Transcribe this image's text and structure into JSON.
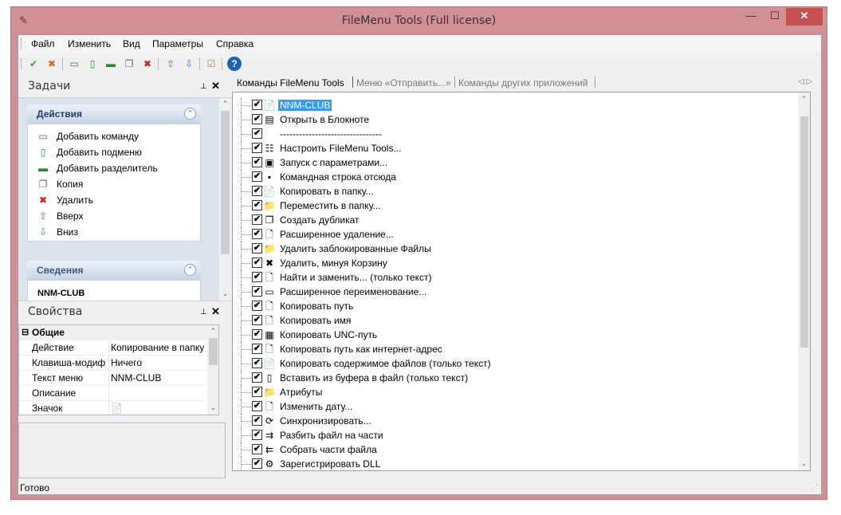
{
  "window": {
    "title": "FileMenu Tools (Full license)",
    "min_glyph": "—",
    "max_glyph": "☐",
    "close_glyph": "✕"
  },
  "menu": [
    "Файл",
    "Изменить",
    "Вид",
    "Параметры",
    "Справка"
  ],
  "toolbar": [
    {
      "icon": "apply-icon",
      "glyph": "✔",
      "color": "#2ea02e"
    },
    {
      "icon": "cancel-icon",
      "glyph": "✖",
      "color": "#e06020"
    },
    {
      "icon": "add-command-icon",
      "glyph": "▭",
      "color": "#2a8a2a"
    },
    {
      "icon": "add-submenu-icon",
      "glyph": "▯",
      "color": "#2a8a2a"
    },
    {
      "icon": "add-separator-icon",
      "glyph": "▬",
      "color": "#2a8a2a"
    },
    {
      "icon": "copy-icon",
      "glyph": "❐",
      "color": "#666666"
    },
    {
      "icon": "delete-icon",
      "glyph": "✖",
      "color": "#cc2020"
    },
    {
      "icon": "move-up-icon",
      "glyph": "⇧",
      "color": "#3a6fc4"
    },
    {
      "icon": "move-down-icon",
      "glyph": "⇩",
      "color": "#3a6fc4"
    },
    {
      "icon": "check-icon",
      "glyph": "☑",
      "color": "#c08030"
    },
    {
      "icon": "help-icon",
      "glyph": "?",
      "color": "#1f5fbf"
    }
  ],
  "tasks_pane": {
    "title": "Задачи",
    "pin_glyph": "⊥",
    "close_glyph": "✕",
    "actions_group": {
      "title": "Действия",
      "toggle_glyph": "⌃",
      "items": [
        {
          "label": "Добавить команду",
          "icon": "add-command-icon",
          "glyph": "▭",
          "color": "#2a8a2a"
        },
        {
          "label": "Добавить подменю",
          "icon": "add-submenu-icon",
          "glyph": "▯",
          "color": "#2a8a2a"
        },
        {
          "label": "Добавить разделитель",
          "icon": "add-separator-icon",
          "glyph": "▬",
          "color": "#2a8a2a"
        },
        {
          "label": "Копия",
          "icon": "copy-icon",
          "glyph": "❐",
          "color": "#666666"
        },
        {
          "label": "Удалить",
          "icon": "delete-icon",
          "glyph": "✖",
          "color": "#cc2020"
        },
        {
          "label": "Вверх",
          "icon": "move-up-icon",
          "glyph": "⇧",
          "color": "#3a6fc4"
        },
        {
          "label": "Вниз",
          "icon": "move-down-icon",
          "glyph": "⇩",
          "color": "#3a6fc4"
        }
      ]
    },
    "info_group": {
      "title": "Сведения",
      "toggle_glyph": "⌃",
      "partial_text": "NNM-CLUB"
    }
  },
  "props_pane": {
    "title": "Свойства",
    "pin_glyph": "⊥",
    "close_glyph": "✕",
    "category": "Общие",
    "category_glyph": "⊟",
    "rows": [
      {
        "key": "Действие",
        "value": "Копирование в папку"
      },
      {
        "key": "Клавиша-модиф",
        "value": "Ничего"
      },
      {
        "key": "Текст меню",
        "value": "NNM-CLUB"
      },
      {
        "key": "Описание",
        "value": ""
      },
      {
        "key": "Значок",
        "value": "📄"
      }
    ]
  },
  "tabs": [
    {
      "label": "Команды  FileMenu Tools",
      "active": true
    },
    {
      "label": "Меню «Отправить...»",
      "active": false
    },
    {
      "label": "Команды других приложений",
      "active": false
    }
  ],
  "tab_nav": "◁ ▷",
  "tree_items": [
    {
      "label": "NNM-CLUB",
      "icon": "copy-to-folder-icon",
      "glyph": "📄",
      "selected": true
    },
    {
      "label": "Открыть в Блокноте",
      "icon": "notepad-icon",
      "glyph": "▤"
    },
    {
      "label": "--------------------------------",
      "icon": "separator-icon",
      "glyph": ""
    },
    {
      "label": "Настроить FileMenu Tools...",
      "icon": "settings-icon",
      "glyph": "☷"
    },
    {
      "label": "Запуск с параметрами...",
      "icon": "run-icon",
      "glyph": "▣"
    },
    {
      "label": "Командная строка отсюда",
      "icon": "cmd-icon",
      "glyph": "▪"
    },
    {
      "label": "Копировать в папку...",
      "icon": "copy-to-folder-icon",
      "glyph": "📄"
    },
    {
      "label": "Переместить в папку...",
      "icon": "move-to-folder-icon",
      "glyph": "📁"
    },
    {
      "label": "Создать дубликат",
      "icon": "duplicate-icon",
      "glyph": "❐"
    },
    {
      "label": "Расширенное удаление...",
      "icon": "advanced-delete-icon",
      "glyph": "🗋"
    },
    {
      "label": "Удалить заблокированные Файлы",
      "icon": "delete-locked-icon",
      "glyph": "📁"
    },
    {
      "label": "Удалить, минуя Корзину",
      "icon": "delete-icon",
      "glyph": "✖"
    },
    {
      "label": "Найти и заменить... (только текст)",
      "icon": "find-replace-icon",
      "glyph": "🗋"
    },
    {
      "label": "Расширенное переименование...",
      "icon": "rename-icon",
      "glyph": "▭"
    },
    {
      "label": "Копировать путь",
      "icon": "copy-path-icon",
      "glyph": "🗋"
    },
    {
      "label": "Копировать имя",
      "icon": "copy-name-icon",
      "glyph": "🗋"
    },
    {
      "label": "Копировать UNC-путь",
      "icon": "copy-unc-icon",
      "glyph": "▦"
    },
    {
      "label": "Копировать путь как интернет-адрес",
      "icon": "copy-url-icon",
      "glyph": "🗋"
    },
    {
      "label": "Копировать содержимое файлов (только текст)",
      "icon": "copy-content-icon",
      "glyph": "📄"
    },
    {
      "label": "Вставить из буфера в файл (только текст)",
      "icon": "paste-to-file-icon",
      "glyph": "▯"
    },
    {
      "label": "Атрибуты",
      "icon": "attributes-icon",
      "glyph": "📁"
    },
    {
      "label": "Изменить дату...",
      "icon": "change-date-icon",
      "glyph": "🗋"
    },
    {
      "label": "Синхронизировать...",
      "icon": "sync-icon",
      "glyph": "⟳"
    },
    {
      "label": "Разбить файл на части",
      "icon": "split-icon",
      "glyph": "⇉"
    },
    {
      "label": "Собрать части файла",
      "icon": "join-icon",
      "glyph": "⇇"
    },
    {
      "label": "Зарегистрировать DLL",
      "icon": "register-dll-icon",
      "glyph": "⚙"
    }
  ],
  "status": "Готово",
  "check_glyph": "✔",
  "scroll_up_glyph": "⌃",
  "scroll_down_glyph": "⌄",
  "colors": {
    "titlebar": "#d28f94",
    "close_button": "#c75050",
    "selection": "#3399ff",
    "group_header_text": "#39577f"
  }
}
